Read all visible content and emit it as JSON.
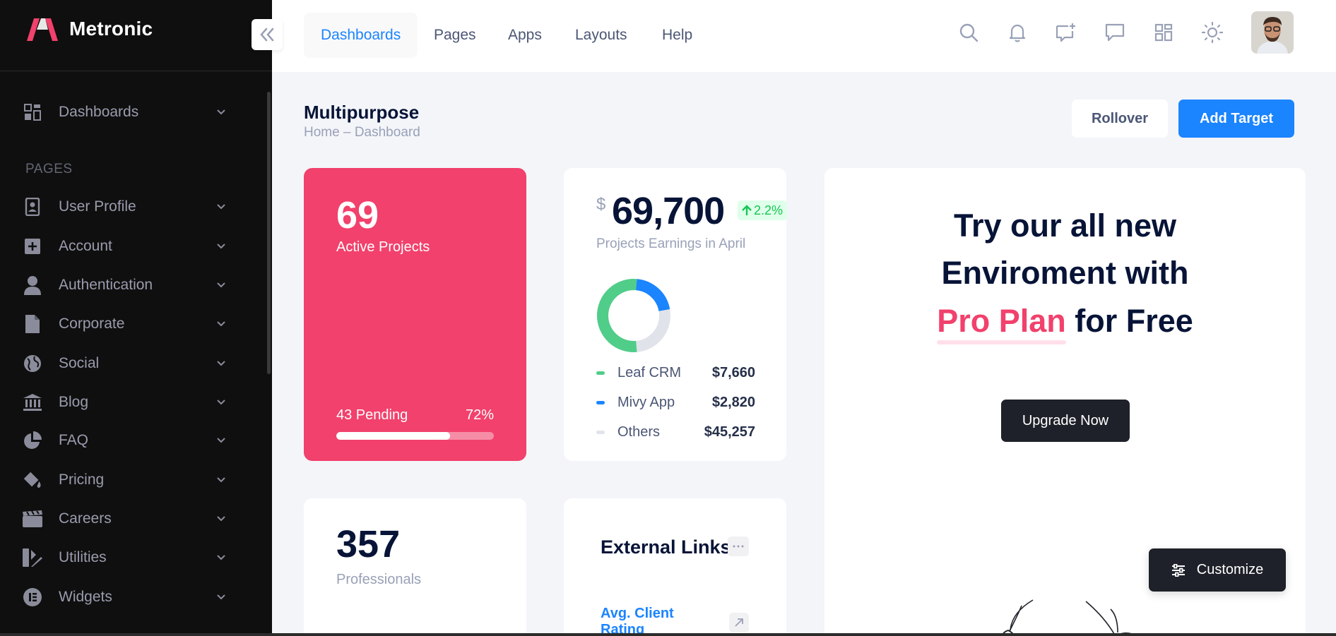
{
  "brand": {
    "name": "Metronic"
  },
  "sidebar": {
    "top_item": {
      "label": "Dashboards",
      "icon": "dashboards-icon"
    },
    "section_title": "PAGES",
    "items": [
      {
        "label": "User Profile",
        "icon": "user-profile-icon"
      },
      {
        "label": "Account",
        "icon": "account-icon"
      },
      {
        "label": "Authentication",
        "icon": "user-icon"
      },
      {
        "label": "Corporate",
        "icon": "document-icon"
      },
      {
        "label": "Social",
        "icon": "globe-icon"
      },
      {
        "label": "Blog",
        "icon": "bank-icon"
      },
      {
        "label": "FAQ",
        "icon": "pie-chart-icon"
      },
      {
        "label": "Pricing",
        "icon": "paint-bucket-icon"
      },
      {
        "label": "Careers",
        "icon": "clapperboard-icon"
      },
      {
        "label": "Utilities",
        "icon": "design-tools-icon"
      },
      {
        "label": "Widgets",
        "icon": "elementor-icon"
      }
    ]
  },
  "header": {
    "tabs": [
      {
        "label": "Dashboards",
        "active": true
      },
      {
        "label": "Pages"
      },
      {
        "label": "Apps"
      },
      {
        "label": "Layouts"
      },
      {
        "label": "Help"
      }
    ],
    "icons": [
      "search-icon",
      "bell-icon",
      "message-add-icon",
      "chat-icon",
      "grid-icon",
      "sun-icon"
    ]
  },
  "toolbar": {
    "title": "Multipurpose",
    "breadcrumb_home": "Home",
    "breadcrumb_sep": "–",
    "breadcrumb_current": "Dashboard",
    "rollover_label": "Rollover",
    "add_target_label": "Add Target"
  },
  "active_projects": {
    "value": "69",
    "label": "Active Projects",
    "pending": "43 Pending",
    "percent_text": "72%",
    "progress": 0.72,
    "color": "#f1416c"
  },
  "earnings": {
    "currency": "$",
    "value": "69,700",
    "change": "2.2%",
    "label": "Projects Earnings in April",
    "legend": [
      {
        "name": "Leaf CRM",
        "value": "$7,660",
        "color": "#50cd89"
      },
      {
        "name": "Mivy App",
        "value": "$2,820",
        "color": "#1b84ff"
      },
      {
        "name": "Others",
        "value": "$45,257",
        "color": "#e1e3ea"
      }
    ]
  },
  "promo": {
    "line1": "Try our all new",
    "line2": "Enviroment with",
    "highlight": "Pro Plan",
    "line3_rest": "for Free",
    "button": "Upgrade Now"
  },
  "professionals": {
    "value": "357",
    "label": "Professionals"
  },
  "external_links": {
    "title": "External Links",
    "first_link": "Avg. Client Rating"
  },
  "customize": {
    "label": "Customize"
  }
}
